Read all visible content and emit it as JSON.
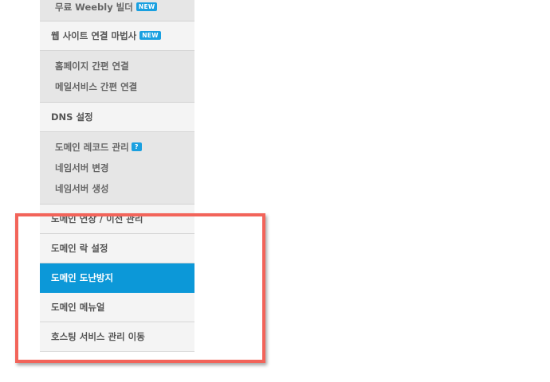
{
  "menu": {
    "weebly": {
      "label": "무료 Weebly 빌더",
      "badge": "NEW"
    },
    "wizard": {
      "label": "웹 사이트 연결 마법사",
      "badge": "NEW"
    },
    "connect_subitems": [
      {
        "label": "홈페이지 간편 연결"
      },
      {
        "label": "메일서비스 간편 연결"
      }
    ],
    "dns": {
      "label": "DNS 설정"
    },
    "dns_subitems": [
      {
        "label": "도메인 레코드 관리",
        "badge": "?"
      },
      {
        "label": "네임서버 변경"
      },
      {
        "label": "네임서버 생성"
      }
    ],
    "partial": {
      "label": "도메인 연장 / 이전 관리"
    },
    "lock": {
      "label": "도메인 락 설정"
    },
    "theft": {
      "label": "도메인 도난방지"
    },
    "manual": {
      "label": "도메인 메뉴얼"
    },
    "hosting": {
      "label": "호스팅 서비스 관리 이동"
    }
  },
  "colors": {
    "active_bg": "#0c98d8",
    "highlight_border": "#f2645a",
    "badge": "#1aa0e0"
  }
}
